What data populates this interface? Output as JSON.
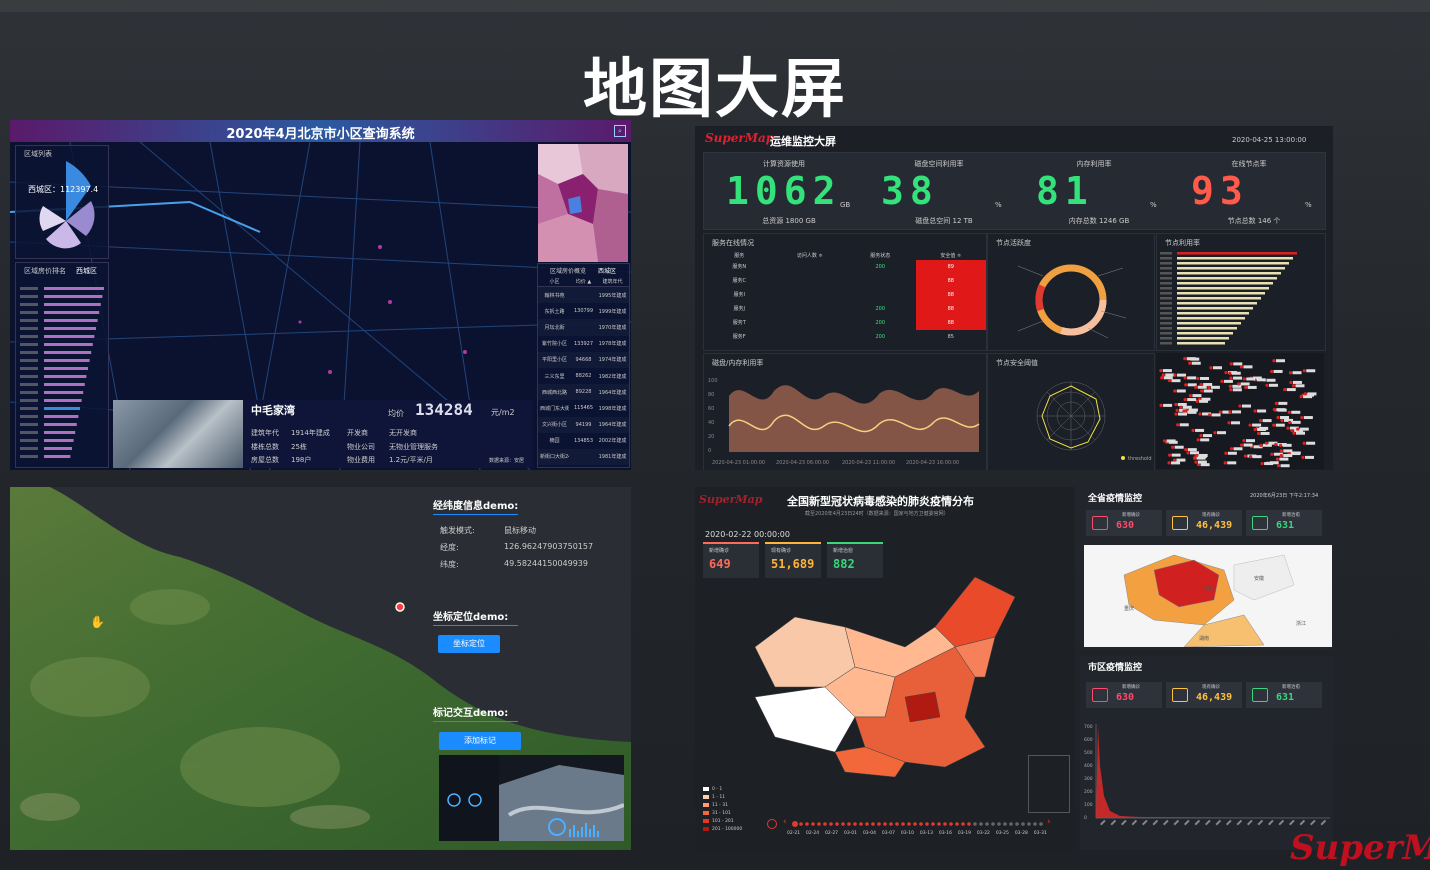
{
  "page_title": "地图大屏",
  "p1": {
    "title": "2020年4月北京市小区查询系统",
    "legend_title": "区域列表",
    "district_value": "西城区：112397.4",
    "rank_title": "区域房价排名",
    "rank_tab": "西城区",
    "rank_title2": "区域房价概览",
    "rank_tab2": "西城区",
    "table_head": [
      "小区",
      "均价 ▲",
      "建筑年代"
    ],
    "table_rows": [
      [
        "翰林书苑",
        "",
        "1995年建成"
      ],
      [
        "东拆土路",
        "130799",
        "1999年建成"
      ],
      [
        "月坛北街",
        "",
        "1970年建成"
      ],
      [
        "紫竹院小区",
        "133927",
        "1978年建成"
      ],
      [
        "平阳里小区",
        "94668",
        "1974年建成"
      ],
      [
        "三义东里",
        "88262",
        "1982年建成"
      ],
      [
        "西城西北路",
        "89228",
        "1964年建成"
      ],
      [
        "西城门东大街",
        "115465",
        "1998年建成"
      ],
      [
        "文兴街小区",
        "94199",
        "1964年建成"
      ],
      [
        "楠园",
        "134853",
        "2002年建成"
      ],
      [
        "新街口大街24",
        "",
        "1981年建成"
      ]
    ],
    "card_name": "中毛家湾",
    "card_avg_label": "均价",
    "card_avg": "134284",
    "card_unit": "元/m2",
    "f1_label": "建筑年代",
    "f1_value": "1914年建成",
    "f2_label": "楼栋总数",
    "f2_value": "25栋",
    "f3_label": "房屋总数",
    "f3_value": "198户",
    "f4_label": "开发商",
    "f4_value": "无开发商",
    "f5_label": "物业公司",
    "f5_value": "无物业管理服务",
    "f6_label": "物业费用",
    "f6_value": "1.2元/平米/月",
    "footnote": "数据来源：安居"
  },
  "p2": {
    "logo": "SuperMap",
    "title": "运维监控大屏",
    "datetime": "2020-04-25 13:00:00",
    "stats": [
      {
        "label": "计算资源使用",
        "value": "1062",
        "unit": "GB",
        "sub": "总资源 1800 GB",
        "color": "#33e27a"
      },
      {
        "label": "磁盘空间利用率",
        "value": "38",
        "unit": "%",
        "sub": "磁盘总空间 12 TB",
        "color": "#33e27a"
      },
      {
        "label": "内存利用率",
        "value": "81",
        "unit": "%",
        "sub": "内存总数 1246 GB",
        "color": "#33e27a"
      },
      {
        "label": "在线节点率",
        "value": "93",
        "unit": "%",
        "sub": "节点总数 146 个",
        "color": "#ff5a4a"
      }
    ],
    "service_title": "服务在线情况",
    "service_head": [
      "服务",
      "访问人数 ≑",
      "服务状态",
      "安全值 ≑"
    ],
    "service_rows": [
      [
        "服务N",
        "",
        "200",
        "89"
      ],
      [
        "服务C",
        "",
        "",
        "88"
      ],
      [
        "服务I",
        "",
        "",
        "88"
      ],
      [
        "服务J",
        "",
        "200",
        "88"
      ],
      [
        "服务T",
        "",
        "200",
        "88"
      ],
      [
        "服务F",
        "",
        "200",
        "85"
      ]
    ],
    "node_active_title": "节点活跃度",
    "node_util_title": "节点利用率",
    "disk_title": "磁盘/内存利用率",
    "node_safe_title": "节点安全阈值",
    "x_ticks": [
      "2020-04-23 01:00:00",
      "2020-04-23 06:00:00",
      "2020-04-23 11:00:00",
      "2020-04-23 16:00:00"
    ],
    "y_ticks": [
      "100",
      "80",
      "60",
      "40",
      "20",
      "0"
    ],
    "threshold_legend": "threshold"
  },
  "p3": {
    "g1_title": "经纬度信息demo:",
    "trigger_label": "触发模式:",
    "trigger_value": "鼠标移动",
    "lon_label": "经度:",
    "lon_value": "126.96247903750157",
    "lat_label": "纬度:",
    "lat_value": "49.58244150049939",
    "g2_title": "坐标定位demo:",
    "btn_locate": "坐标定位",
    "g3_title": "标记交互demo:",
    "btn_mark": "添加标记"
  },
  "p4": {
    "logo": "SuperMap",
    "title": "全国新型冠状病毒感染的肺炎疫情分布",
    "subtitle": "截至2020年4月23日24时（数据来源：国家与地方卫健委官网）",
    "date": "2020-02-22 00:00:00",
    "stats": [
      {
        "label": "新增确诊",
        "value": "649",
        "color": "#ff6a5a"
      },
      {
        "label": "现有确诊",
        "value": "51,689",
        "color": "#ffb43a"
      },
      {
        "label": "新增治愈",
        "value": "882",
        "color": "#39d67a"
      }
    ],
    "legend": [
      "0 - 1",
      "1 - 11",
      "11 - 31",
      "31 - 101",
      "101 - 201",
      "201 - 100000"
    ],
    "legend_colors": [
      "#ffffff",
      "#ffd0b0",
      "#ff9c70",
      "#f2683a",
      "#e03a20",
      "#b01a10"
    ],
    "timeline": [
      "02-21",
      "02-24",
      "02-27",
      "03-01",
      "03-04",
      "03-07",
      "03-10",
      "03-13",
      "03-16",
      "03-19",
      "03-22",
      "03-25",
      "03-28",
      "03-31"
    ]
  },
  "p5": {
    "title": "全省疫情监控",
    "datetime": "2020年6月23日 下午2:17:34",
    "stats": [
      {
        "label": "新增确诊",
        "value": "630",
        "color": "#ff4a6a"
      },
      {
        "label": "现有确诊",
        "value": "46,439",
        "color": "#ffc23a"
      },
      {
        "label": "新增治愈",
        "value": "631",
        "color": "#39d67a"
      }
    ],
    "city_title": "市区疫情监控",
    "city_stats": [
      {
        "label": "新增确诊",
        "value": "630",
        "color": "#ff4a6a"
      },
      {
        "label": "现有确诊",
        "value": "46,439",
        "color": "#ffc23a"
      },
      {
        "label": "新增治愈",
        "value": "631",
        "color": "#39d67a"
      }
    ],
    "y_ticks": [
      "700",
      "600",
      "500",
      "400",
      "300",
      "200",
      "100",
      "0"
    ],
    "map_labels": [
      "湖北",
      "安徽",
      "湖南",
      "浙江",
      "重庆"
    ]
  },
  "watermark": "SuperMap"
}
